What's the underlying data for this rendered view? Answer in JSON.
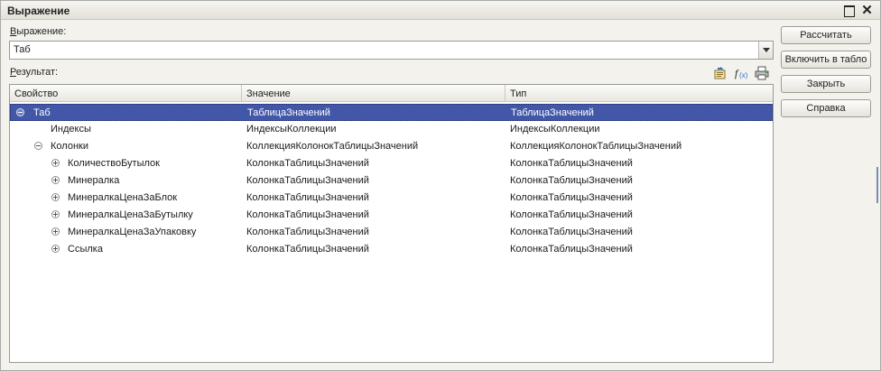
{
  "window": {
    "title": "Выражение",
    "max_icon": "maximize-icon",
    "close_glyph": "✕"
  },
  "expression": {
    "label_underlined": "В",
    "label_rest": "ыражение:",
    "value": "Таб"
  },
  "result": {
    "label_underlined": "Р",
    "label_rest": "езультат:"
  },
  "toolbar": {
    "icons": [
      "export-icon",
      "function-icon",
      "print-icon"
    ]
  },
  "table": {
    "columns": [
      "Свойство",
      "Значение",
      "Тип"
    ],
    "rows": [
      {
        "name": "Таб",
        "value": "ТаблицаЗначений",
        "type": "ТаблицаЗначений"
      },
      {
        "name": "Индексы",
        "value": "ИндексыКоллекции",
        "type": "ИндексыКоллекции"
      },
      {
        "name": "Колонки",
        "value": "КоллекцияКолонокТаблицыЗначений",
        "type": "КоллекцияКолонокТаблицыЗначений"
      },
      {
        "name": "КоличествоБутылок",
        "value": "КолонкаТаблицыЗначений",
        "type": "КолонкаТаблицыЗначений"
      },
      {
        "name": "Минералка",
        "value": "КолонкаТаблицыЗначений",
        "type": "КолонкаТаблицыЗначений"
      },
      {
        "name": "МинералкаЦенаЗаБлок",
        "value": "КолонкаТаблицыЗначений",
        "type": "КолонкаТаблицыЗначений"
      },
      {
        "name": "МинералкаЦенаЗаБутылку",
        "value": "КолонкаТаблицыЗначений",
        "type": "КолонкаТаблицыЗначений"
      },
      {
        "name": "МинералкаЦенаЗаУпаковку",
        "value": "КолонкаТаблицыЗначений",
        "type": "КолонкаТаблицыЗначений"
      },
      {
        "name": "Ссылка",
        "value": "КолонкаТаблицыЗначений",
        "type": "КолонкаТаблицыЗначений"
      }
    ]
  },
  "buttons": {
    "calculate": "Рассчитать",
    "include": "Включить в табло",
    "close": "Закрыть",
    "help": "Справка"
  }
}
